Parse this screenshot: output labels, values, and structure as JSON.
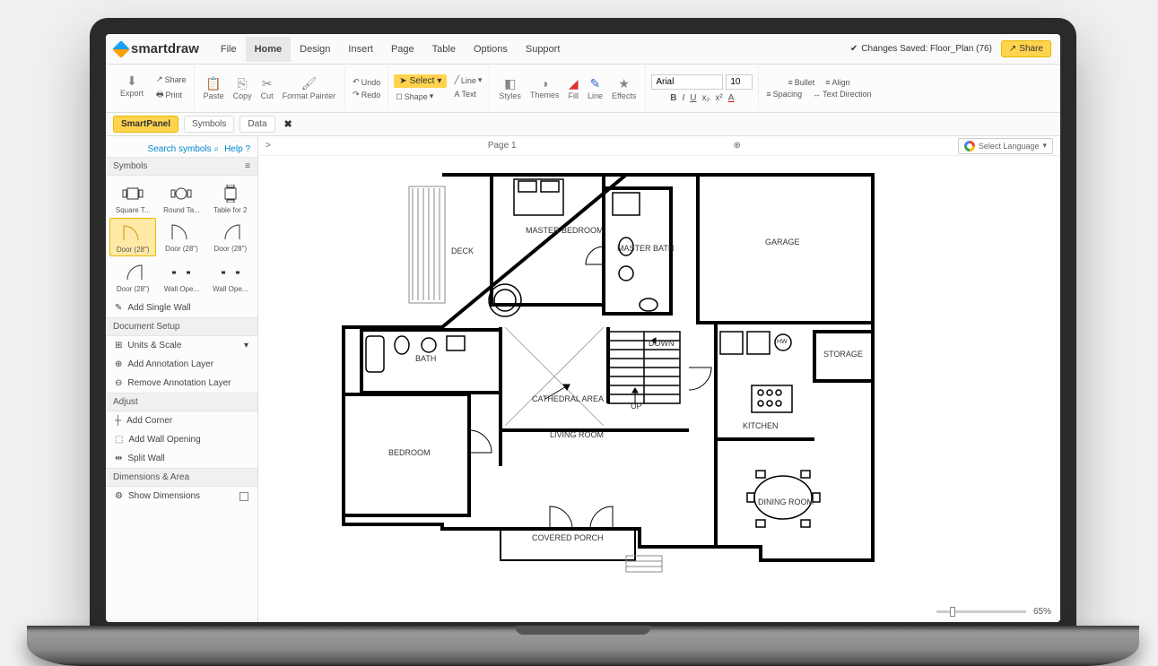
{
  "logo_text": "smartdraw",
  "menu": [
    "File",
    "Home",
    "Design",
    "Insert",
    "Page",
    "Table",
    "Options",
    "Support"
  ],
  "menu_active": 1,
  "saved_label": "Changes Saved: Floor_Plan (76)",
  "share_label": "Share",
  "ribbon": {
    "export": "Export",
    "print": "Print",
    "share_small": "Share",
    "paste": "Paste",
    "copy": "Copy",
    "cut": "Cut",
    "format_painter": "Format Painter",
    "undo": "Undo",
    "redo": "Redo",
    "select": "Select",
    "shape": "Shape",
    "line": "Line",
    "text": "Text",
    "styles": "Styles",
    "themes": "Themes",
    "fill": "Fill",
    "line2": "Line",
    "effects": "Effects",
    "font": "Arial",
    "font_size": "10",
    "bullet": "Bullet",
    "align": "Align",
    "spacing": "Spacing",
    "text_dir": "Text Direction"
  },
  "tabs": {
    "smartpanel": "SmartPanel",
    "symbols": "Symbols",
    "data": "Data"
  },
  "side": {
    "search": "Search symbols",
    "help": "Help",
    "symbols_h": "Symbols",
    "sym_labels": [
      "Square T...",
      "Round Ta...",
      "Table for 2",
      "Door (28\")",
      "Door (28\")",
      "Door (28\")",
      "Door (28\")",
      "Wall Ope...",
      "Wall Ope..."
    ],
    "add_wall": "Add Single Wall",
    "doc_setup": "Document Setup",
    "units": "Units & Scale",
    "add_ann": "Add Annotation Layer",
    "rem_ann": "Remove Annotation Layer",
    "adjust": "Adjust",
    "add_corner": "Add Corner",
    "add_opening": "Add Wall Opening",
    "split_wall": "Split Wall",
    "dimarea": "Dimensions & Area",
    "show_dim": "Show Dimensions"
  },
  "page_label": "Page 1",
  "lang_select": "Select Language",
  "zoom": "65%",
  "rooms": {
    "deck": "DECK",
    "master_bed": "MASTER BEDROOM",
    "master_bath": "MASTER BATH",
    "garage": "GARAGE",
    "bath": "BATH",
    "down": "DOWN",
    "storage": "STORAGE",
    "hw": "HW",
    "up": "UP",
    "cathedral": "CATHEDRAL AREA",
    "living": "LIVING ROOM",
    "kitchen": "KITCHEN",
    "bedroom": "BEDROOM",
    "dining": "DINING ROOM",
    "porch": "COVERED PORCH"
  }
}
